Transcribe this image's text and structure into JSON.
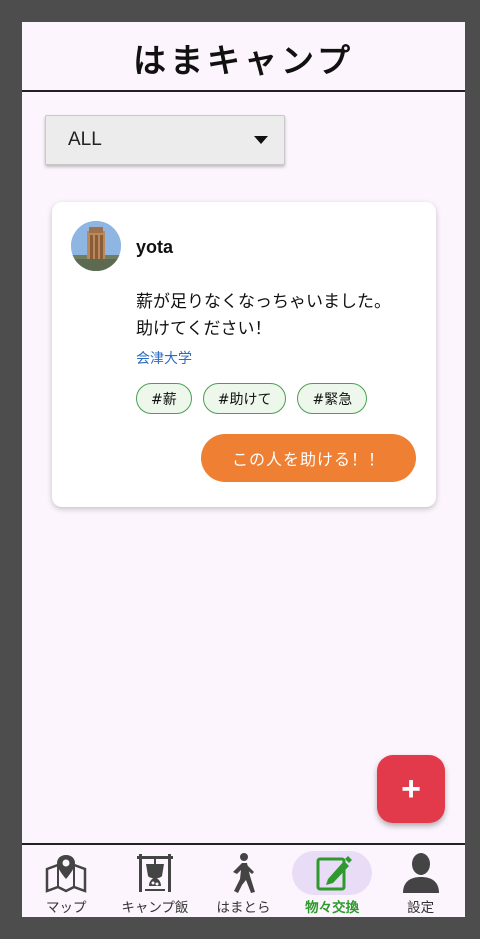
{
  "app": {
    "title": "はまキャンプ"
  },
  "filter": {
    "selected": "ALL"
  },
  "post": {
    "username": "yota",
    "message_lines": [
      "薪が足りなくなっちゃいました。",
      "助けてください！"
    ],
    "university": "会津大学",
    "tags": [
      "#薪",
      "#助けて",
      "#緊急"
    ],
    "help_button": "この人を助ける！！"
  },
  "fab": {
    "label": "+"
  },
  "nav": {
    "items": [
      {
        "label": "マップ",
        "icon": "map-icon"
      },
      {
        "label": "キャンプ飯",
        "icon": "camp-cooking-icon"
      },
      {
        "label": "はまとら",
        "icon": "walking-icon"
      },
      {
        "label": "物々交換",
        "icon": "edit-icon"
      },
      {
        "label": "設定",
        "icon": "person-icon"
      }
    ],
    "active_index": 3
  },
  "colors": {
    "accent_orange": "#ef7f32",
    "fab_red": "#e23a4b",
    "active_green": "#2e9a2e",
    "link_blue": "#2a6cc0",
    "tag_border": "#4aa04e",
    "background": "#fdf5fd"
  }
}
